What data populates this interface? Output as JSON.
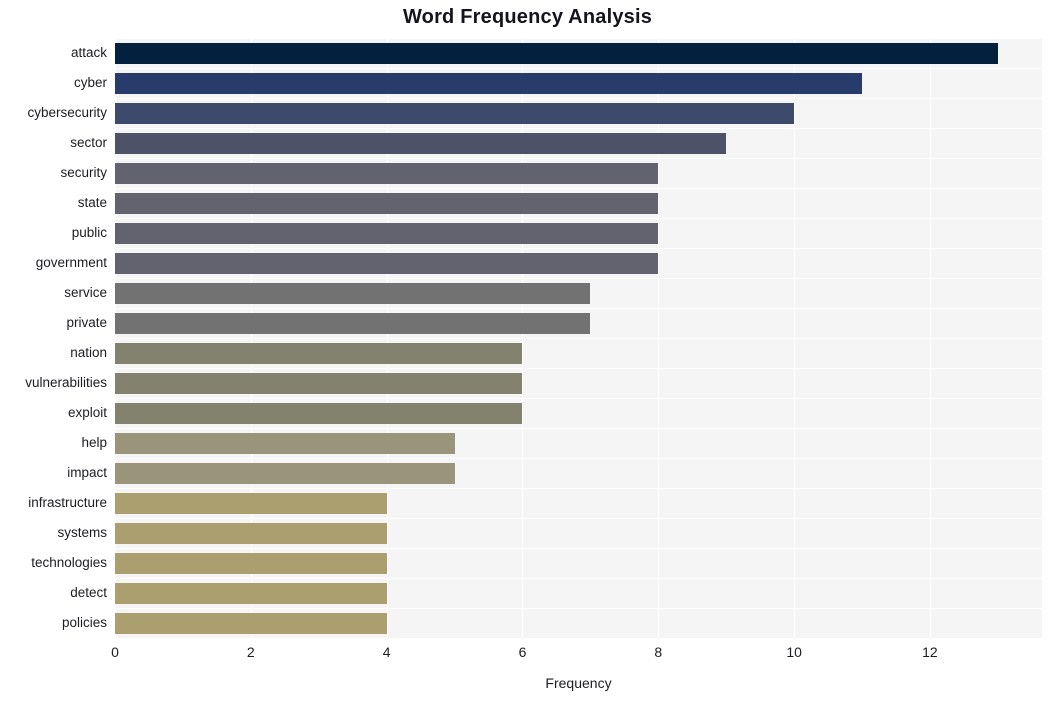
{
  "chart_data": {
    "type": "bar",
    "orientation": "horizontal",
    "title": "Word Frequency Analysis",
    "xlabel": "Frequency",
    "ylabel": "",
    "xlim": [
      0,
      13.65
    ],
    "xticks": [
      0,
      2,
      4,
      6,
      8,
      10,
      12
    ],
    "grid": true,
    "legend": false,
    "categories": [
      "attack",
      "cyber",
      "cybersecurity",
      "sector",
      "security",
      "state",
      "public",
      "government",
      "service",
      "private",
      "nation",
      "vulnerabilities",
      "exploit",
      "help",
      "impact",
      "infrastructure",
      "systems",
      "technologies",
      "detect",
      "policies"
    ],
    "values": [
      13,
      11,
      10,
      9,
      8,
      8,
      8,
      8,
      7,
      7,
      6,
      6,
      6,
      5,
      5,
      4,
      4,
      4,
      4,
      4
    ],
    "bar_colors": [
      "#04203f",
      "#283c6b",
      "#3e4a6b",
      "#4d5269",
      "#62636e",
      "#62636e",
      "#62636e",
      "#62636e",
      "#727272",
      "#727272",
      "#83826f",
      "#83826f",
      "#83826f",
      "#99947a",
      "#99947a",
      "#ab9f6f",
      "#ab9f6f",
      "#ab9f6f",
      "#ab9f6f",
      "#ab9f6f"
    ],
    "plot_background": "#f5f5f6",
    "gridline_color": "#ffffff",
    "title_color": "#14141e"
  }
}
